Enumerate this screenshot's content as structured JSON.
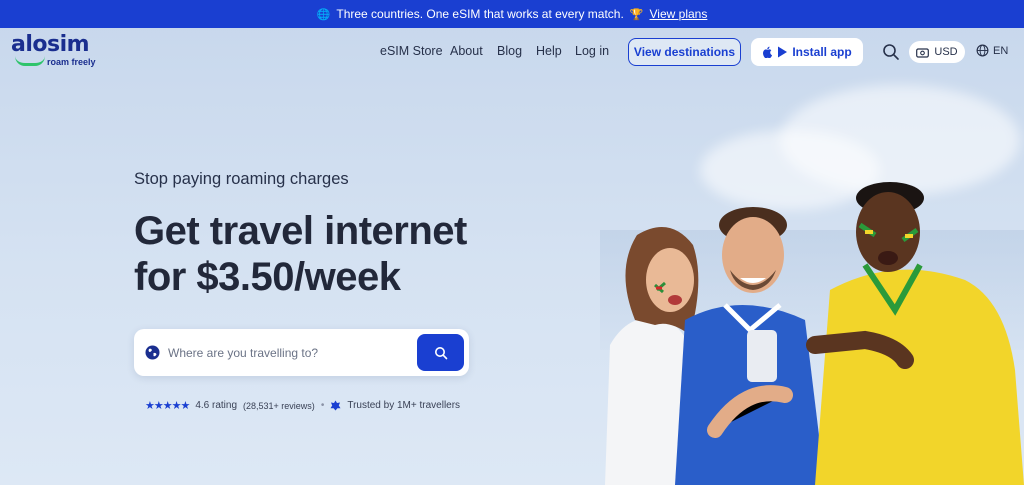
{
  "announcement": {
    "globe_icon": "globe-icon",
    "text": "Three countries. One eSIM that works at every match.",
    "trophy_icon": "trophy-icon",
    "link": "View plans"
  },
  "brand": {
    "name": "alosim",
    "tagline": "roam freely",
    "color": "#1a2e8f",
    "accent": "#2fc46b"
  },
  "nav": {
    "items": [
      "eSIM Store",
      "About",
      "Blog",
      "Help",
      "Log in"
    ],
    "view_destinations": "View destinations",
    "install_app": "Install app",
    "currency": "USD",
    "language": "EN"
  },
  "hero": {
    "eyebrow": "Stop paying roaming charges",
    "headline_line1": "Get travel internet",
    "headline_line2": "for $3.50/week",
    "search_placeholder": "Where are you travelling to?"
  },
  "trust": {
    "stars": "★★★★★",
    "rating_value": 4.6,
    "rating": "4.6 rating",
    "reviews": "(28,531+ reviews)",
    "travellers": "Trusted by 1M+ travellers"
  },
  "colors": {
    "primary": "#1a3fd1",
    "background": "#d5e2f2"
  }
}
